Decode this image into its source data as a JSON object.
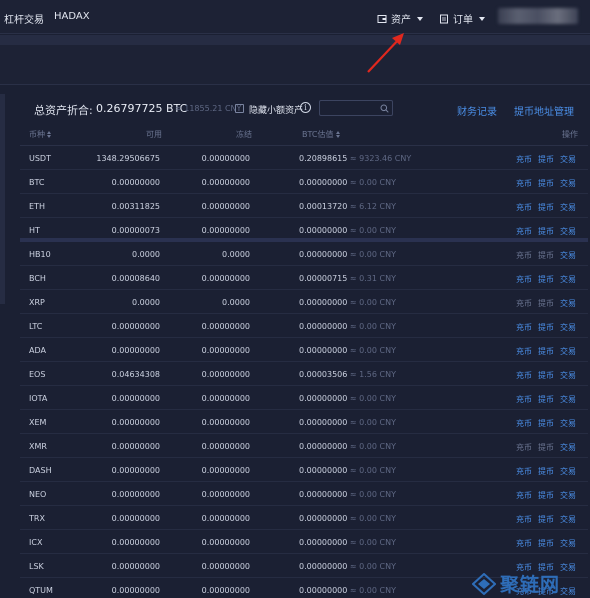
{
  "nav": {
    "margin_trade": "杠杆交易",
    "hadax": "HADAX",
    "assets": "资产",
    "orders": "订单"
  },
  "summary": {
    "label": "总资产折合:",
    "btc_total": "0.26797725 BTC",
    "cny_total": "≈ 11855.21 CNY",
    "hide_small_label": "隐藏小额资产",
    "finance_record": "财务记录",
    "withdraw_address": "提币地址管理"
  },
  "table": {
    "headers": {
      "coin": "币种",
      "available": "可用",
      "frozen": "冻结",
      "btc_value": "BTC估值",
      "actions": "操作"
    },
    "action_labels": {
      "deposit": "充币",
      "withdraw": "提币",
      "trade": "交易"
    },
    "rows": [
      {
        "coin": "USDT",
        "available": "1348.29506675",
        "frozen": "0.00000000",
        "btc": "0.20898615",
        "cny": "≈ 9323.46 CNY"
      },
      {
        "coin": "BTC",
        "available": "0.00000000",
        "frozen": "0.00000000",
        "btc": "0.00000000",
        "cny": "≈ 0.00 CNY"
      },
      {
        "coin": "ETH",
        "available": "0.00311825",
        "frozen": "0.00000000",
        "btc": "0.00013720",
        "cny": "≈ 6.12 CNY"
      },
      {
        "coin": "HT",
        "available": "0.00000073",
        "frozen": "0.00000000",
        "btc": "0.00000000",
        "cny": "≈ 0.00 CNY"
      },
      {
        "coin": "HB10",
        "available": "0.0000",
        "frozen": "0.0000",
        "btc": "0.00000000",
        "cny": "≈ 0.00 CNY"
      },
      {
        "coin": "BCH",
        "available": "0.00008640",
        "frozen": "0.00000000",
        "btc": "0.00000715",
        "cny": "≈ 0.31 CNY"
      },
      {
        "coin": "XRP",
        "available": "0.0000",
        "frozen": "0.0000",
        "btc": "0.00000000",
        "cny": "≈ 0.00 CNY"
      },
      {
        "coin": "LTC",
        "available": "0.00000000",
        "frozen": "0.00000000",
        "btc": "0.00000000",
        "cny": "≈ 0.00 CNY"
      },
      {
        "coin": "ADA",
        "available": "0.00000000",
        "frozen": "0.00000000",
        "btc": "0.00000000",
        "cny": "≈ 0.00 CNY"
      },
      {
        "coin": "EOS",
        "available": "0.04634308",
        "frozen": "0.00000000",
        "btc": "0.00003506",
        "cny": "≈ 1.56 CNY"
      },
      {
        "coin": "IOTA",
        "available": "0.00000000",
        "frozen": "0.00000000",
        "btc": "0.00000000",
        "cny": "≈ 0.00 CNY"
      },
      {
        "coin": "XEM",
        "available": "0.00000000",
        "frozen": "0.00000000",
        "btc": "0.00000000",
        "cny": "≈ 0.00 CNY"
      },
      {
        "coin": "XMR",
        "available": "0.00000000",
        "frozen": "0.00000000",
        "btc": "0.00000000",
        "cny": "≈ 0.00 CNY"
      },
      {
        "coin": "DASH",
        "available": "0.00000000",
        "frozen": "0.00000000",
        "btc": "0.00000000",
        "cny": "≈ 0.00 CNY"
      },
      {
        "coin": "NEO",
        "available": "0.00000000",
        "frozen": "0.00000000",
        "btc": "0.00000000",
        "cny": "≈ 0.00 CNY"
      },
      {
        "coin": "TRX",
        "available": "0.00000000",
        "frozen": "0.00000000",
        "btc": "0.00000000",
        "cny": "≈ 0.00 CNY"
      },
      {
        "coin": "ICX",
        "available": "0.00000000",
        "frozen": "0.00000000",
        "btc": "0.00000000",
        "cny": "≈ 0.00 CNY"
      },
      {
        "coin": "LSK",
        "available": "0.00000000",
        "frozen": "0.00000000",
        "btc": "0.00000000",
        "cny": "≈ 0.00 CNY"
      },
      {
        "coin": "QTUM",
        "available": "0.00000000",
        "frozen": "0.00000000",
        "btc": "0.00000000",
        "cny": "≈ 0.00 CNY"
      }
    ]
  },
  "watermark": {
    "text": "聚链网"
  },
  "colors": {
    "background": "#1b2033",
    "link": "#4b8fe8",
    "annotation_arrow": "#e0281e"
  }
}
